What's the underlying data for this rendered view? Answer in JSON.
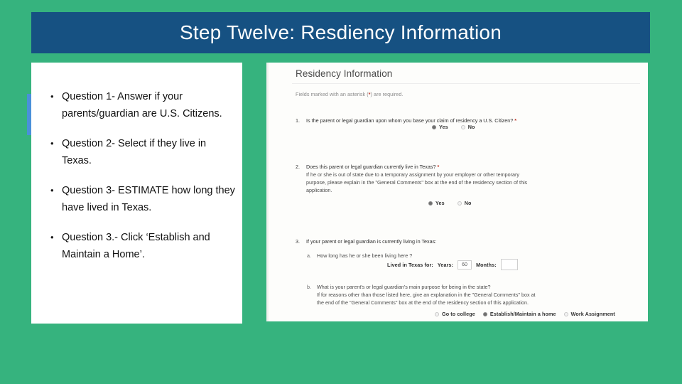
{
  "slide": {
    "title": "Step Twelve: Resdiency Information",
    "background_color": "#36b37e",
    "banner_color": "#165182",
    "accent_color": "#4a90d9"
  },
  "bullets": [
    {
      "marker": "•",
      "text": "Question 1- Answer if your parents/guardian are U.S. Citizens."
    },
    {
      "marker": "•",
      "text": "Question 2- Select if they live in Texas."
    },
    {
      "marker": "•",
      "text": "Question 3- ESTIMATE how long they have lived in Texas."
    },
    {
      "marker": "•",
      "text": "Question 3.- Click ‘Establish and Maintain a Home’."
    }
  ],
  "form": {
    "heading": "Residency Information",
    "required_note_before": "Fields marked with an asterisk (",
    "required_note_asterisk": "*",
    "required_note_after": ") are required.",
    "q1": {
      "number": "1.",
      "text": "Is the parent or legal guardian upon whom you base your claim of residency a U.S. Citizen?",
      "asterisk": "*",
      "options": [
        {
          "label": "Yes",
          "selected": true
        },
        {
          "label": "No",
          "selected": false
        }
      ]
    },
    "q2": {
      "number": "2.",
      "text": "Does this parent or legal guardian currently live in Texas?",
      "asterisk": "*",
      "detail_line1": "If he or she is out of state due to a temporary assignment by your employer or other temporary",
      "detail_line2": "purpose, please explain in the \"General Comments\" box at the end of the residency section of this",
      "detail_line3": "application.",
      "options": [
        {
          "label": "Yes",
          "selected": true
        },
        {
          "label": "No",
          "selected": false
        }
      ]
    },
    "q3": {
      "number": "3.",
      "text": "If your parent or legal guardian is currently living in Texas:",
      "sub_a": {
        "letter": "a.",
        "text": "How long has he or she been living here ?",
        "field_prefix": "Lived in Texas for:",
        "years_label": "Years:",
        "years_value": "60",
        "months_label": "Months:",
        "months_value": ""
      },
      "sub_b": {
        "letter": "b.",
        "text": "What is your parent's or legal guardian's main purpose for being in the state?",
        "detail_line1": "If for reasons other than those listed here, give an explanation in the \"General Comments\" box at",
        "detail_line2": "the end of the \"General Comments\" box at the end of the residency section of this application.",
        "options": [
          {
            "label": "Go to college",
            "selected": false
          },
          {
            "label": "Establish/Maintain a home",
            "selected": true
          },
          {
            "label": "Work Assignment",
            "selected": false
          }
        ]
      }
    }
  }
}
